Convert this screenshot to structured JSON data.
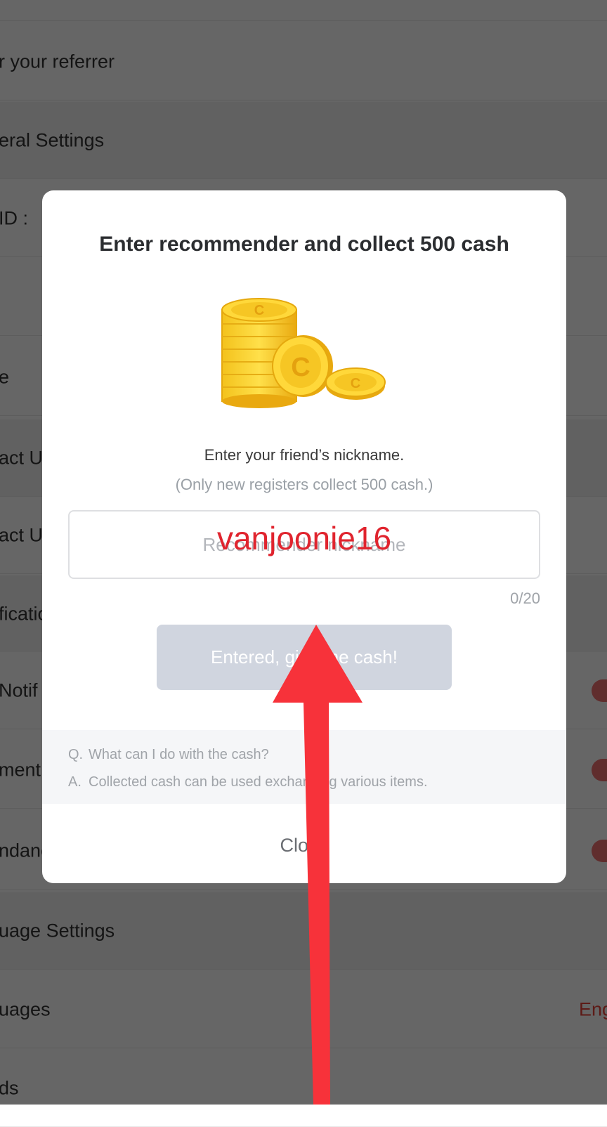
{
  "background": {
    "rows": [
      {
        "label": "",
        "kind": "item"
      },
      {
        "label": "r your referrer",
        "kind": "item"
      },
      {
        "label": "eral Settings",
        "kind": "section"
      },
      {
        "label": "ID :",
        "kind": "item"
      },
      {
        "label": "",
        "kind": "item"
      },
      {
        "label": "e",
        "kind": "item"
      },
      {
        "label": "act U",
        "kind": "section"
      },
      {
        "label": "act U",
        "kind": "item"
      },
      {
        "label": "ficatio",
        "kind": "section"
      },
      {
        "label": "Notif",
        "kind": "item",
        "toggle": true
      },
      {
        "label": "ment",
        "kind": "item",
        "toggle": true
      },
      {
        "label": "ndanc",
        "kind": "item",
        "toggle": true
      },
      {
        "label": "uage Settings",
        "kind": "section"
      },
      {
        "label": "uages",
        "kind": "item",
        "value": "Eng"
      },
      {
        "label": "ds",
        "kind": "item"
      }
    ]
  },
  "modal": {
    "title": "Enter recommender and collect 500 cash",
    "coin_letter": "C",
    "prompt": "Enter your friend’s nickname.",
    "sub_prompt": "(Only new registers collect 500 cash.)",
    "input_placeholder": "Recommender nickname",
    "input_value": "",
    "counter": "0/20",
    "submit_label": "Entered, give me cash!",
    "faq": {
      "q_tag": "Q.",
      "question": "What can I do with the cash?",
      "a_tag": "A.",
      "answer": "Collected cash can be used exchanging various items."
    },
    "close_label": "Close"
  },
  "annotation": {
    "overlay_text": "vanjoonie16",
    "arrow_color": "#f7323a",
    "text_color": "#e0242e"
  },
  "colors": {
    "dim": "rgba(0,0,0,0.6)",
    "button_disabled": "#d0d5df",
    "toggle": "#f07070",
    "accent_red": "#e8443a"
  }
}
